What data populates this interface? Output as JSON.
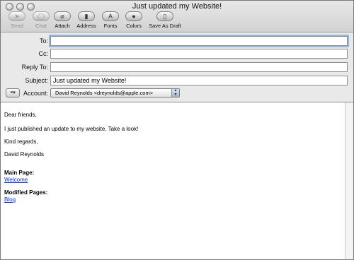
{
  "window": {
    "title": "Just updated my Website!"
  },
  "toolbar": {
    "items": [
      {
        "label": "Send",
        "glyph": "➤",
        "enabled": false
      },
      {
        "label": "Chat",
        "glyph": "◯",
        "enabled": false
      },
      {
        "label": "Attach",
        "glyph": "⌀",
        "enabled": true
      },
      {
        "label": "Address",
        "glyph": "▮",
        "enabled": true
      },
      {
        "label": "Fonts",
        "glyph": "A",
        "enabled": true
      },
      {
        "label": "Colors",
        "glyph": "●",
        "enabled": true
      },
      {
        "label": "Save As Draft",
        "glyph": "▯",
        "enabled": true
      }
    ]
  },
  "headers": {
    "to": {
      "label": "To:",
      "value": ""
    },
    "cc": {
      "label": "Cc:",
      "value": ""
    },
    "reply_to": {
      "label": "Reply To:",
      "value": ""
    },
    "subject": {
      "label": "Subject:",
      "value": "Just updated my Website!"
    },
    "account": {
      "label": "Account:",
      "value": "David Reynolds <dreynolds@apple.com>"
    },
    "options_glyph": "≡▾"
  },
  "message": {
    "greeting": "Dear friends,",
    "line1": "I just published an update to my website. Take a look!",
    "closing": "Kind regards,",
    "signature": "David Reynolds",
    "main_page_label": "Main Page:",
    "main_page_link": "Welcome",
    "modified_pages_label": "Modified Pages:",
    "modified_pages_link": "Blog"
  }
}
